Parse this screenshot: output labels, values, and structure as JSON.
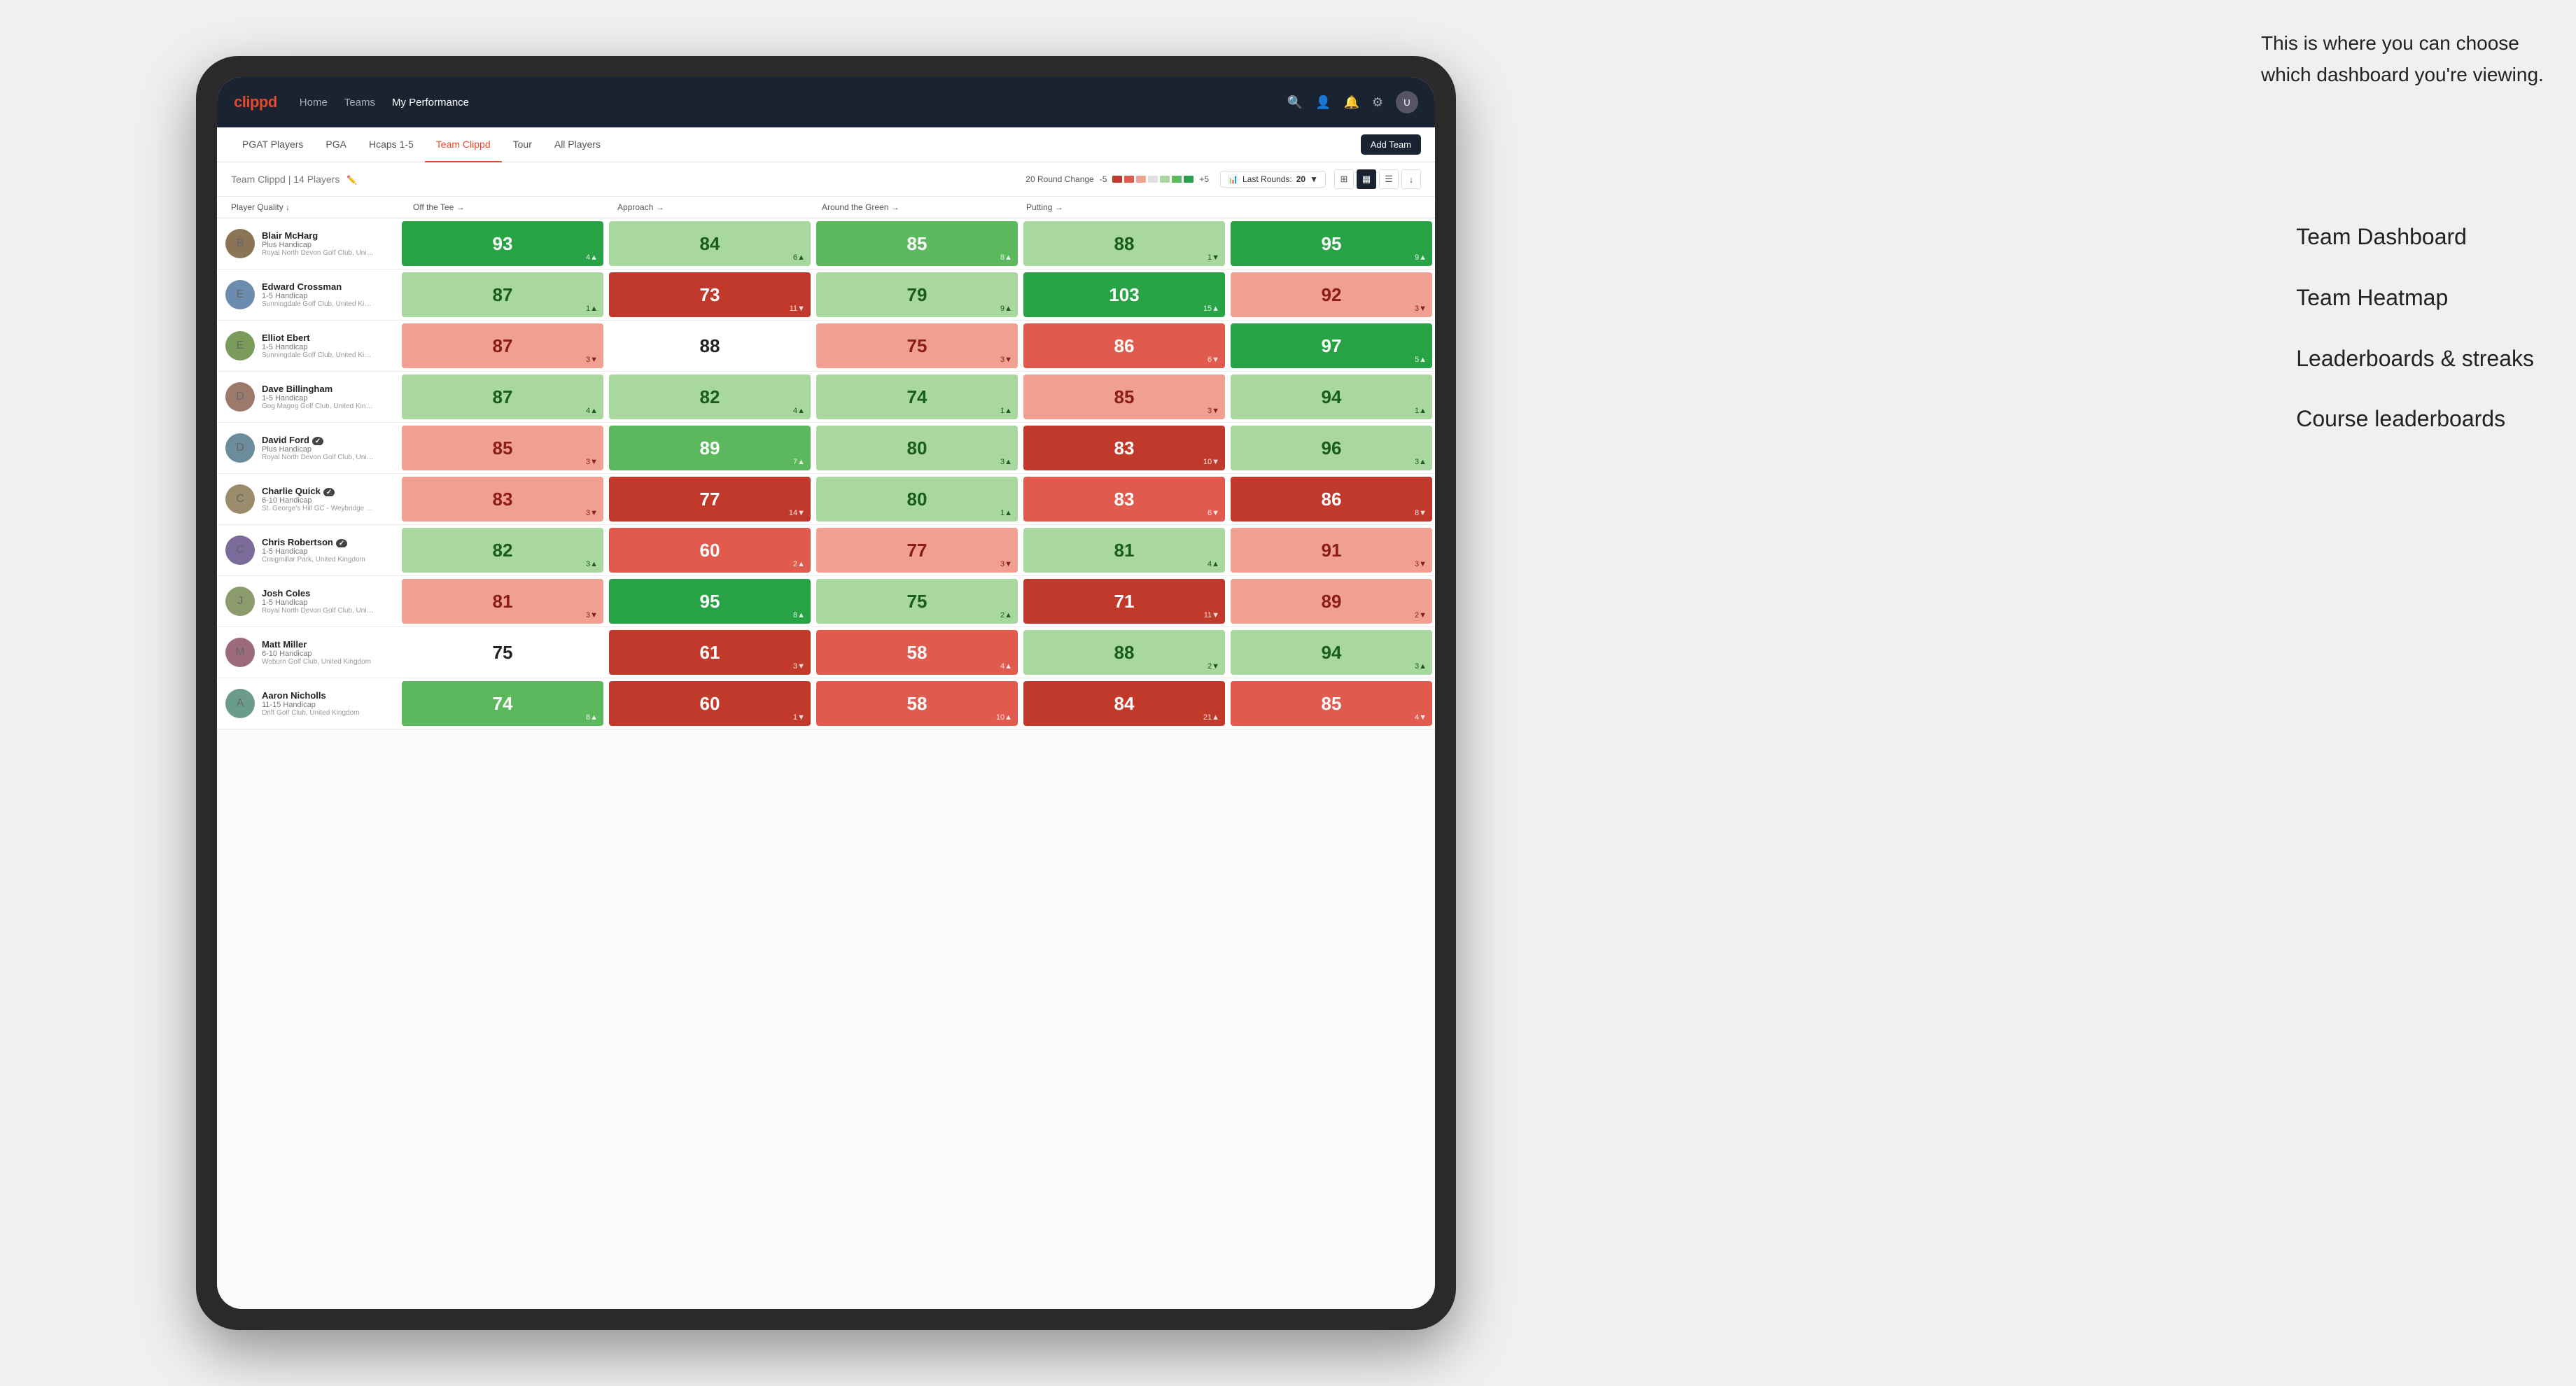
{
  "annotation": {
    "text": "This is where you can choose which dashboard you're viewing.",
    "labels": [
      "Team Dashboard",
      "Team Heatmap",
      "Leaderboards & streaks",
      "Course leaderboards"
    ]
  },
  "nav": {
    "logo": "clippd",
    "links": [
      "Home",
      "Teams",
      "My Performance"
    ],
    "active_link": "My Performance"
  },
  "sub_nav": {
    "links": [
      "PGAT Players",
      "PGA",
      "Hcaps 1-5",
      "Team Clippd",
      "Tour",
      "All Players"
    ],
    "active_link": "Team Clippd",
    "add_button": "Add Team"
  },
  "team_header": {
    "name": "Team Clippd",
    "count": "14 Players",
    "round_change_label": "20 Round Change",
    "range_min": "-5",
    "range_max": "+5",
    "last_rounds_label": "Last Rounds:",
    "last_rounds_value": "20"
  },
  "table": {
    "columns": [
      "Player Quality ↓",
      "Off the Tee →",
      "Approach →",
      "Around the Green →",
      "Putting →"
    ],
    "players": [
      {
        "name": "Blair McHarg",
        "handicap": "Plus Handicap",
        "club": "Royal North Devon Golf Club, United Kingdom",
        "stats": [
          {
            "value": "93",
            "change": "4▲",
            "dir": "up",
            "color": "green-dark"
          },
          {
            "value": "84",
            "change": "6▲",
            "dir": "up",
            "color": "green-light"
          },
          {
            "value": "85",
            "change": "8▲",
            "dir": "up",
            "color": "green-med"
          },
          {
            "value": "88",
            "change": "1▼",
            "dir": "down",
            "color": "green-light"
          },
          {
            "value": "95",
            "change": "9▲",
            "dir": "up",
            "color": "green-dark"
          }
        ]
      },
      {
        "name": "Edward Crossman",
        "handicap": "1-5 Handicap",
        "club": "Sunningdale Golf Club, United Kingdom",
        "stats": [
          {
            "value": "87",
            "change": "1▲",
            "dir": "up",
            "color": "green-light"
          },
          {
            "value": "73",
            "change": "11▼",
            "dir": "down",
            "color": "red-dark"
          },
          {
            "value": "79",
            "change": "9▲",
            "dir": "up",
            "color": "green-light"
          },
          {
            "value": "103",
            "change": "15▲",
            "dir": "up",
            "color": "green-dark"
          },
          {
            "value": "92",
            "change": "3▼",
            "dir": "down",
            "color": "red-light"
          }
        ]
      },
      {
        "name": "Elliot Ebert",
        "handicap": "1-5 Handicap",
        "club": "Sunningdale Golf Club, United Kingdom",
        "stats": [
          {
            "value": "87",
            "change": "3▼",
            "dir": "down",
            "color": "red-light"
          },
          {
            "value": "88",
            "change": "",
            "dir": "neutral",
            "color": "white-bg"
          },
          {
            "value": "75",
            "change": "3▼",
            "dir": "down",
            "color": "red-light"
          },
          {
            "value": "86",
            "change": "6▼",
            "dir": "down",
            "color": "red-med"
          },
          {
            "value": "97",
            "change": "5▲",
            "dir": "up",
            "color": "green-dark"
          }
        ]
      },
      {
        "name": "Dave Billingham",
        "handicap": "1-5 Handicap",
        "club": "Gog Magog Golf Club, United Kingdom",
        "stats": [
          {
            "value": "87",
            "change": "4▲",
            "dir": "up",
            "color": "green-light"
          },
          {
            "value": "82",
            "change": "4▲",
            "dir": "up",
            "color": "green-light"
          },
          {
            "value": "74",
            "change": "1▲",
            "dir": "up",
            "color": "green-light"
          },
          {
            "value": "85",
            "change": "3▼",
            "dir": "down",
            "color": "red-light"
          },
          {
            "value": "94",
            "change": "1▲",
            "dir": "up",
            "color": "green-light"
          }
        ]
      },
      {
        "name": "David Ford",
        "handicap": "Plus Handicap",
        "club": "Royal North Devon Golf Club, United Kingdom",
        "stats": [
          {
            "value": "85",
            "change": "3▼",
            "dir": "down",
            "color": "red-light"
          },
          {
            "value": "89",
            "change": "7▲",
            "dir": "up",
            "color": "green-med"
          },
          {
            "value": "80",
            "change": "3▲",
            "dir": "up",
            "color": "green-light"
          },
          {
            "value": "83",
            "change": "10▼",
            "dir": "down",
            "color": "red-dark"
          },
          {
            "value": "96",
            "change": "3▲",
            "dir": "up",
            "color": "green-light"
          }
        ]
      },
      {
        "name": "Charlie Quick",
        "handicap": "6-10 Handicap",
        "club": "St. George's Hill GC - Weybridge - Surrey, Uni...",
        "stats": [
          {
            "value": "83",
            "change": "3▼",
            "dir": "down",
            "color": "red-light"
          },
          {
            "value": "77",
            "change": "14▼",
            "dir": "down",
            "color": "red-dark"
          },
          {
            "value": "80",
            "change": "1▲",
            "dir": "up",
            "color": "green-light"
          },
          {
            "value": "83",
            "change": "6▼",
            "dir": "down",
            "color": "red-med"
          },
          {
            "value": "86",
            "change": "8▼",
            "dir": "down",
            "color": "red-dark"
          }
        ]
      },
      {
        "name": "Chris Robertson",
        "handicap": "1-5 Handicap",
        "club": "Craigmillar Park, United Kingdom",
        "stats": [
          {
            "value": "82",
            "change": "3▲",
            "dir": "up",
            "color": "green-light"
          },
          {
            "value": "60",
            "change": "2▲",
            "dir": "up",
            "color": "red-med"
          },
          {
            "value": "77",
            "change": "3▼",
            "dir": "down",
            "color": "red-light"
          },
          {
            "value": "81",
            "change": "4▲",
            "dir": "up",
            "color": "green-light"
          },
          {
            "value": "91",
            "change": "3▼",
            "dir": "down",
            "color": "red-light"
          }
        ]
      },
      {
        "name": "Josh Coles",
        "handicap": "1-5 Handicap",
        "club": "Royal North Devon Golf Club, United Kingdom",
        "stats": [
          {
            "value": "81",
            "change": "3▼",
            "dir": "down",
            "color": "red-light"
          },
          {
            "value": "95",
            "change": "8▲",
            "dir": "up",
            "color": "green-dark"
          },
          {
            "value": "75",
            "change": "2▲",
            "dir": "up",
            "color": "green-light"
          },
          {
            "value": "71",
            "change": "11▼",
            "dir": "down",
            "color": "red-dark"
          },
          {
            "value": "89",
            "change": "2▼",
            "dir": "down",
            "color": "red-light"
          }
        ]
      },
      {
        "name": "Matt Miller",
        "handicap": "6-10 Handicap",
        "club": "Woburn Golf Club, United Kingdom",
        "stats": [
          {
            "value": "75",
            "change": "",
            "dir": "neutral",
            "color": "white-bg"
          },
          {
            "value": "61",
            "change": "3▼",
            "dir": "down",
            "color": "red-dark"
          },
          {
            "value": "58",
            "change": "4▲",
            "dir": "up",
            "color": "red-med"
          },
          {
            "value": "88",
            "change": "2▼",
            "dir": "down",
            "color": "green-light"
          },
          {
            "value": "94",
            "change": "3▲",
            "dir": "up",
            "color": "green-light"
          }
        ]
      },
      {
        "name": "Aaron Nicholls",
        "handicap": "11-15 Handicap",
        "club": "Drift Golf Club, United Kingdom",
        "stats": [
          {
            "value": "74",
            "change": "8▲",
            "dir": "up",
            "color": "green-med"
          },
          {
            "value": "60",
            "change": "1▼",
            "dir": "down",
            "color": "red-dark"
          },
          {
            "value": "58",
            "change": "10▲",
            "dir": "up",
            "color": "red-med"
          },
          {
            "value": "84",
            "change": "21▲",
            "dir": "up",
            "color": "red-dark"
          },
          {
            "value": "85",
            "change": "4▼",
            "dir": "down",
            "color": "red-med"
          }
        ]
      }
    ]
  }
}
